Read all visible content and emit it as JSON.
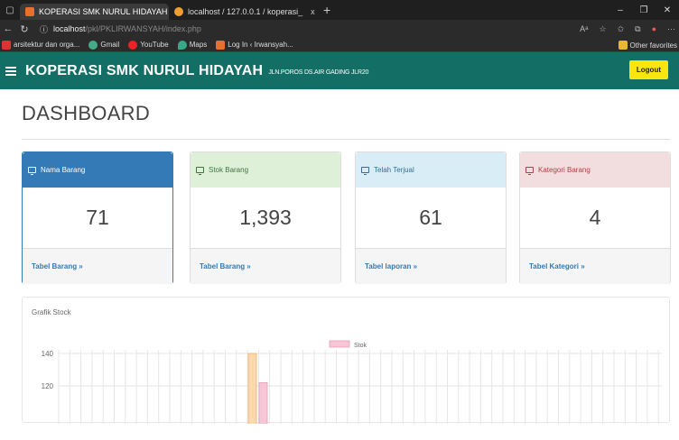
{
  "browser": {
    "tabs": [
      {
        "title": "KOPERASI SMK NURUL HIDAYAH",
        "close": "x"
      },
      {
        "title": "localhost / 127.0.0.1 / koperasi_",
        "close": "x"
      }
    ],
    "url_host": "localhost",
    "url_path": "/pkl/PKLIRWANSYAH/index.php",
    "bookmarks": [
      "arsitektur dan orga...",
      "Gmail",
      "YouTube",
      "Maps",
      "Log In ‹ Irwansyah..."
    ],
    "other_favorites": "Other favorites"
  },
  "app": {
    "brand": "KOPERASI SMK NURUL HIDAYAH",
    "address": "JLN.POROS DS.AIR GADING JLR20",
    "logout": "Logout"
  },
  "page": {
    "title": "DASHBOARD"
  },
  "cards": [
    {
      "label": "Nama Barang",
      "value": "71",
      "link": "Tabel Barang »"
    },
    {
      "label": "Stok Barang",
      "value": "1,393",
      "link": "Tabel Barang »"
    },
    {
      "label": "Telah Terjual",
      "value": "61",
      "link": "Tabel laporan »"
    },
    {
      "label": "Kategori Barang",
      "value": "4",
      "link": "Tabel Kategori »"
    }
  ],
  "chart_title": "Grafik Stock",
  "colors": {
    "header": "#136e66",
    "logout": "#f7e70f",
    "bar_orange": "#fbd9b0",
    "bar_pink": "#f7c6d6"
  },
  "chart_data": {
    "type": "bar",
    "series": [
      {
        "name": "Stok"
      }
    ],
    "y_ticks": [
      140,
      120
    ],
    "visible_bars": [
      140,
      122
    ]
  }
}
